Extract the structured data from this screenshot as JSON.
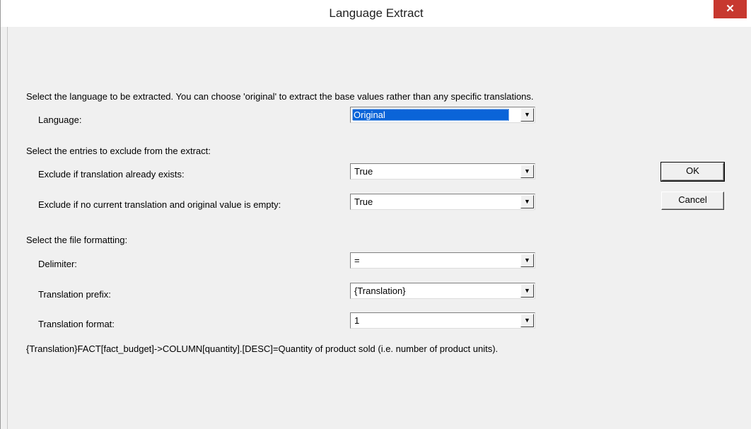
{
  "window": {
    "title": "Language Extract",
    "close_label": "✕"
  },
  "intro": "Select the language to be extracted.  You can choose 'original' to extract the base values rather than any specific translations.",
  "language": {
    "label": "Language:",
    "value": "Original"
  },
  "exclude_section": {
    "heading": "Select the entries to exclude from the extract:",
    "translation_exists": {
      "label": "Exclude if translation already exists:",
      "value": "True"
    },
    "no_translation_empty": {
      "label": "Exclude if no current translation and original value is empty:",
      "value": "True"
    }
  },
  "format_section": {
    "heading": "Select the file formatting:",
    "delimiter": {
      "label": "Delimiter:",
      "value": "="
    },
    "prefix": {
      "label": "Translation prefix:",
      "value": "{Translation}"
    },
    "format": {
      "label": "Translation format:",
      "value": "1"
    },
    "example": "{Translation}FACT[fact_budget]->COLUMN[quantity].[DESC]=Quantity of product sold (i.e. number of product units)."
  },
  "buttons": {
    "ok": "OK",
    "cancel": "Cancel"
  },
  "icons": {
    "dropdown": "▼"
  }
}
